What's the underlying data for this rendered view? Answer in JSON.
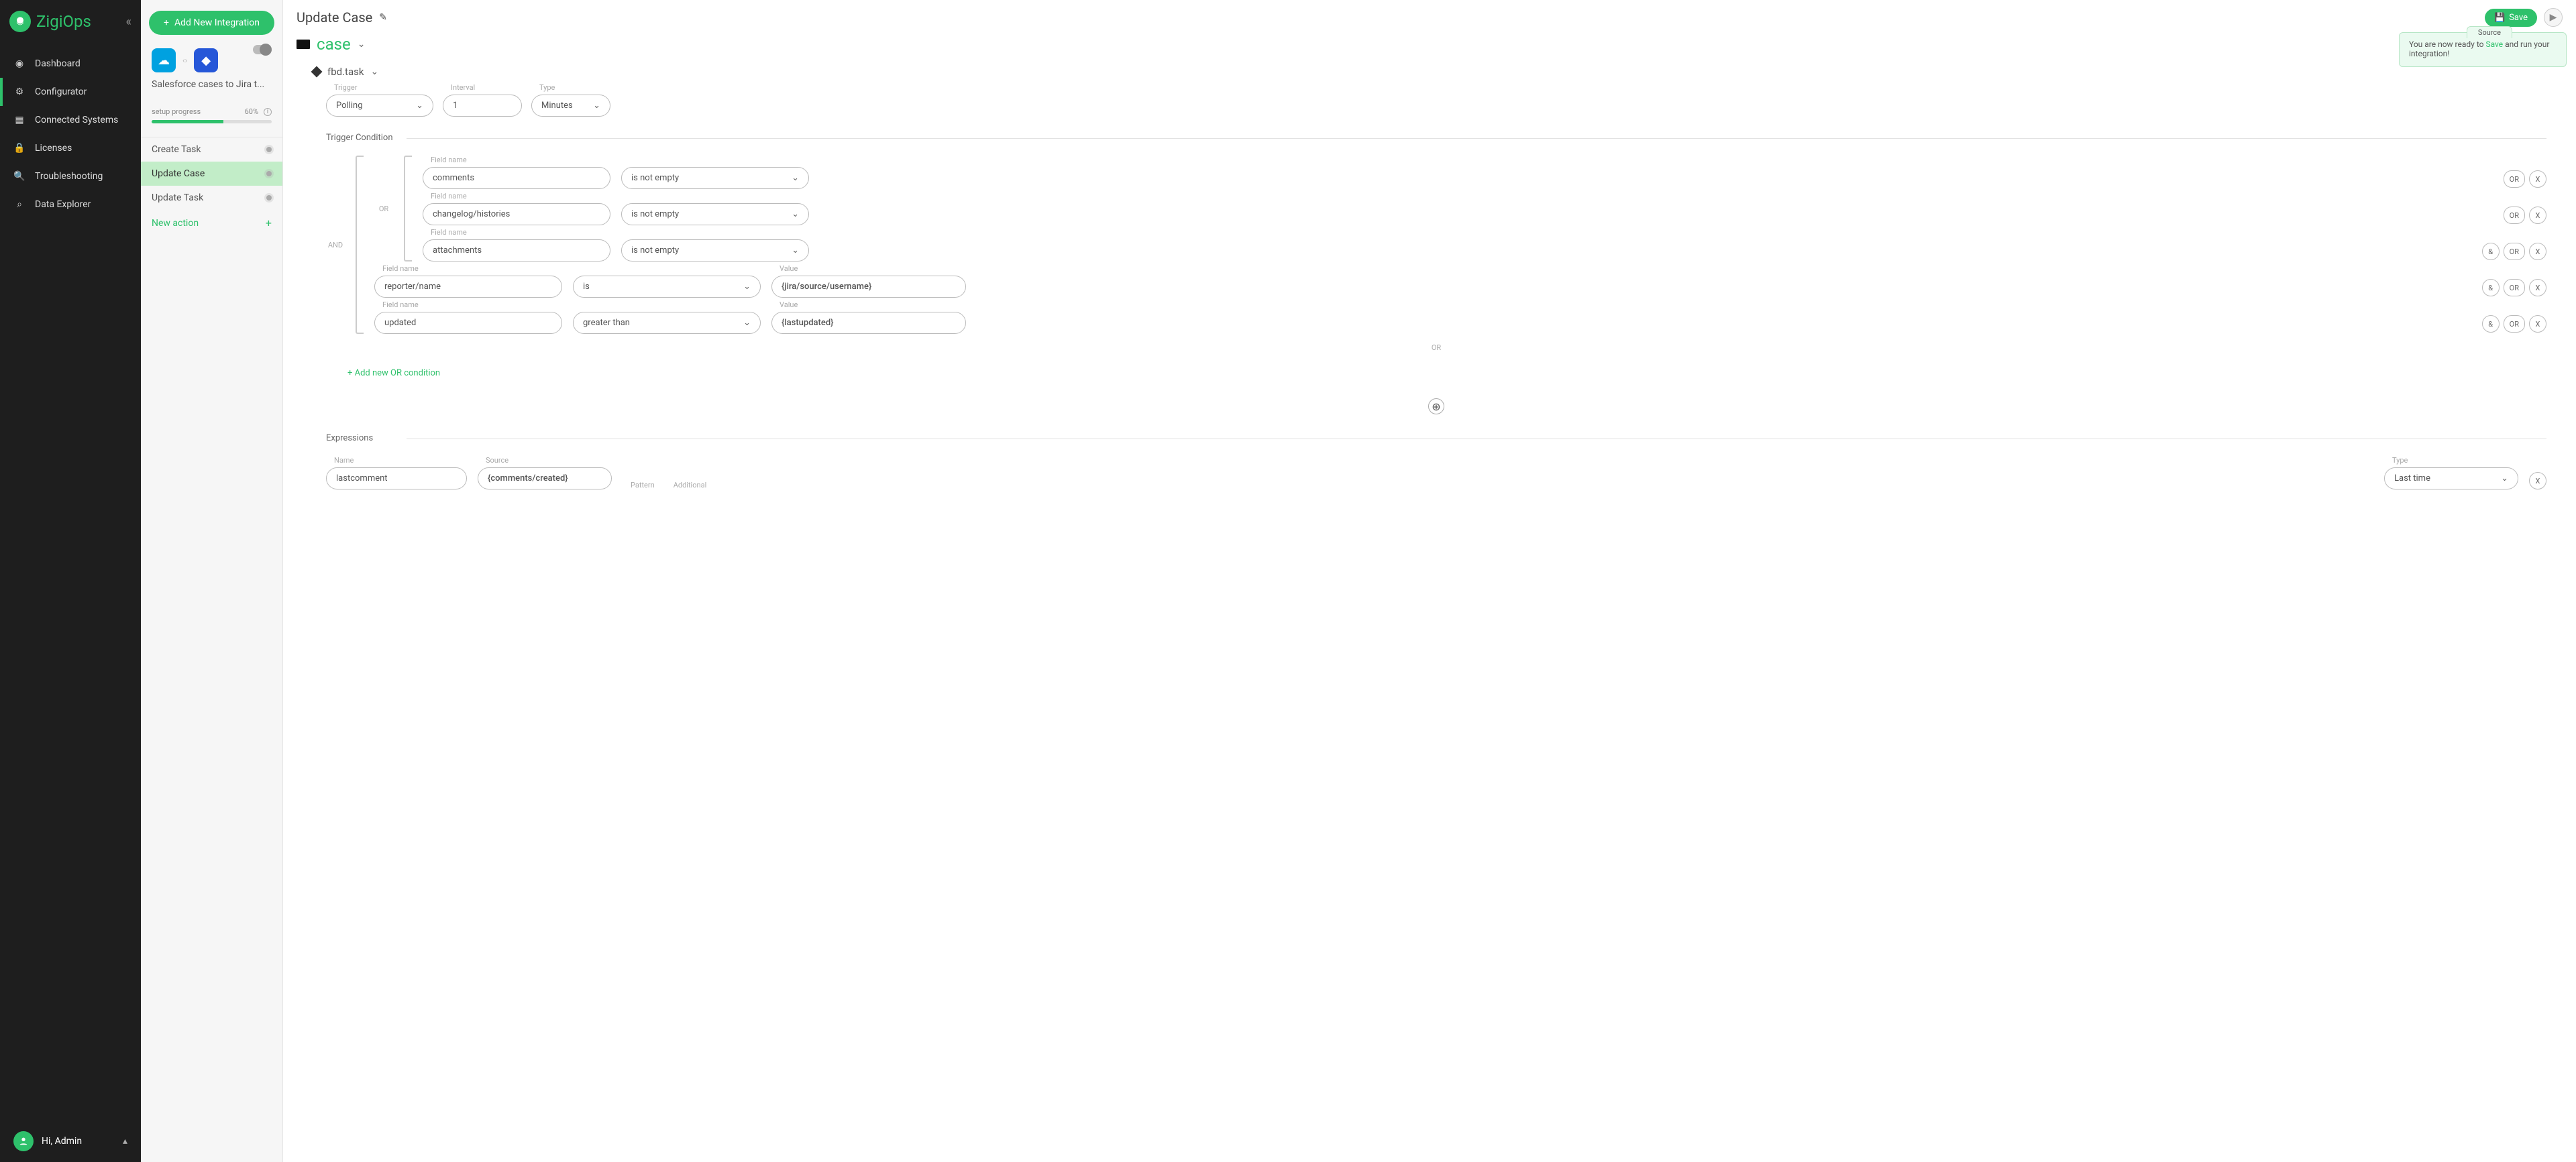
{
  "app": {
    "name": "ZigiOps"
  },
  "sidebar": {
    "items": [
      {
        "label": "Dashboard"
      },
      {
        "label": "Configurator"
      },
      {
        "label": "Connected Systems"
      },
      {
        "label": "Licenses"
      },
      {
        "label": "Troubleshooting"
      },
      {
        "label": "Data Explorer"
      }
    ],
    "user_label": "Hi, Admin"
  },
  "panel": {
    "add_button": "Add New Integration",
    "integration_title": "Salesforce cases to Jira t...",
    "progress_label": "setup progress",
    "progress_value": "60%",
    "actions": [
      {
        "label": "Create Task"
      },
      {
        "label": "Update Case"
      },
      {
        "label": "Update Task"
      }
    ],
    "new_action": "New action"
  },
  "header": {
    "title": "Update Case",
    "save": "Save"
  },
  "entity": {
    "label": "case",
    "sub_label": "fbd.task"
  },
  "toast": {
    "tab": "Source",
    "prefix": "You are now ready to ",
    "save_word": "Save",
    "suffix": " and run your integration!"
  },
  "trigger": {
    "trigger_label": "Trigger",
    "trigger_value": "Polling",
    "interval_label": "Interval",
    "interval_value": "1",
    "type_label": "Type",
    "type_value": "Minutes"
  },
  "section_trigger_condition": "Trigger Condition",
  "cond": {
    "field_name": "Field name",
    "value_label": "Value",
    "and": "AND",
    "or": "OR",
    "rows_or": [
      {
        "field": "comments",
        "op": "is not empty"
      },
      {
        "field": "changelog/histories",
        "op": "is not empty"
      },
      {
        "field": "attachments",
        "op": "is not empty"
      }
    ],
    "rows_and": [
      {
        "field": "reporter/name",
        "op": "is",
        "value": "{jira/source/username}"
      },
      {
        "field": "updated",
        "op": "greater than",
        "value": "{lastupdated}"
      }
    ],
    "chips": {
      "amp": "&",
      "or": "OR",
      "x": "X"
    },
    "divider_or": "OR",
    "add_or": "+ Add new OR condition"
  },
  "section_expressions": "Expressions",
  "expr": {
    "name_label": "Name",
    "name_value": "lastcomment",
    "source_label": "Source",
    "source_value": "{comments/created}",
    "pattern_label": "Pattern",
    "additional_label": "Additional",
    "type_label": "Type",
    "type_value": "Last time"
  }
}
